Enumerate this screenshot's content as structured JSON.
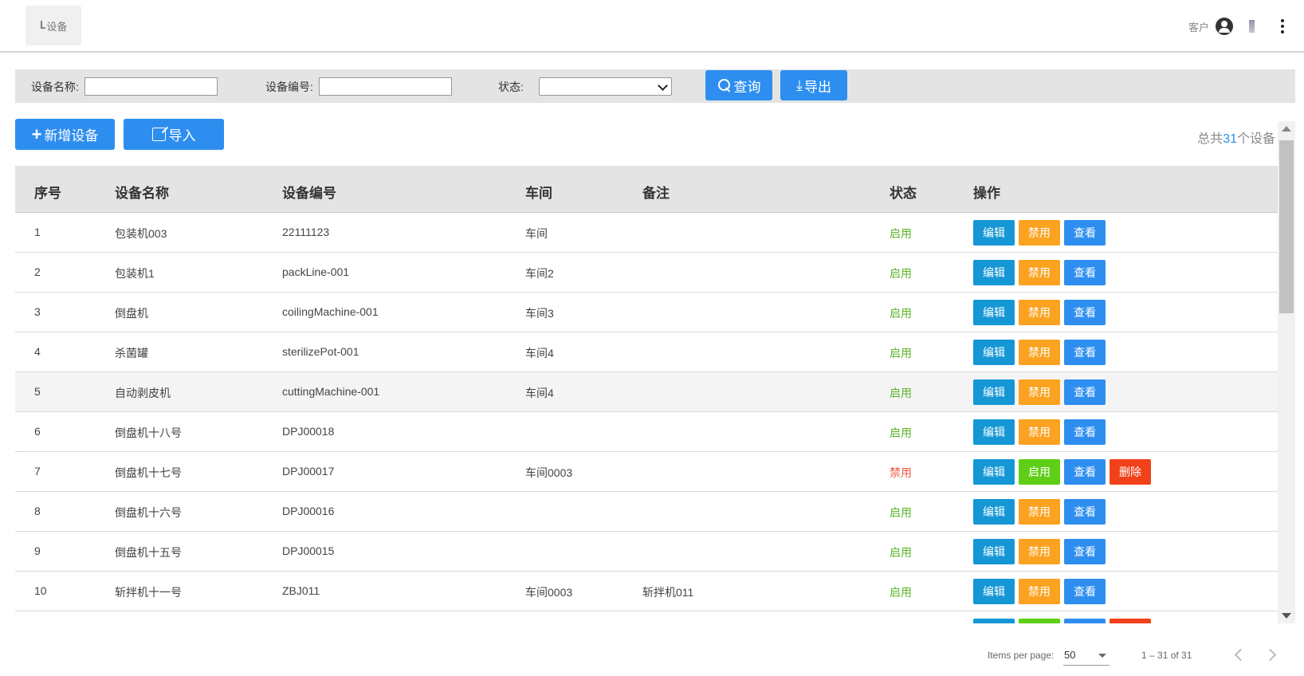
{
  "header": {
    "logo_glyph": "L",
    "logo_text": "设备",
    "username": "客户"
  },
  "filters": {
    "name_label": "设备名称:",
    "code_label": "设备编号:",
    "status_label": "状态:",
    "name_value": "",
    "code_value": "",
    "status_value": "",
    "search_label": "查询",
    "export_label": "导出"
  },
  "actions": {
    "add_label": "新增设备",
    "import_label": "导入",
    "total_prefix": "总共",
    "total_count": "31",
    "total_suffix": "个设备"
  },
  "table": {
    "columns": [
      "序号",
      "设备名称",
      "设备编号",
      "车间",
      "备注",
      "状态",
      "操作"
    ],
    "rows": [
      {
        "no": "1",
        "name": "包装机003",
        "code": "22111123",
        "workshop": "车间",
        "note": "",
        "status": "启用",
        "ops": [
          "编辑",
          "禁用",
          "查看"
        ]
      },
      {
        "no": "2",
        "name": "包装机1",
        "code": "packLine-001",
        "workshop": "车间2",
        "note": "",
        "status": "启用",
        "ops": [
          "编辑",
          "禁用",
          "查看"
        ]
      },
      {
        "no": "3",
        "name": "倒盘机",
        "code": "coilingMachine-001",
        "workshop": "车间3",
        "note": "",
        "status": "启用",
        "ops": [
          "编辑",
          "禁用",
          "查看"
        ]
      },
      {
        "no": "4",
        "name": "杀菌罐",
        "code": "sterilizePot-001",
        "workshop": "车间4",
        "note": "",
        "status": "启用",
        "ops": [
          "编辑",
          "禁用",
          "查看"
        ]
      },
      {
        "no": "5",
        "name": "自动剥皮机",
        "code": "cuttingMachine-001",
        "workshop": "车间4",
        "note": "",
        "status": "启用",
        "ops": [
          "编辑",
          "禁用",
          "查看"
        ]
      },
      {
        "no": "6",
        "name": "倒盘机十八号",
        "code": "DPJ00018",
        "workshop": "",
        "note": "",
        "status": "启用",
        "ops": [
          "编辑",
          "禁用",
          "查看"
        ]
      },
      {
        "no": "7",
        "name": "倒盘机十七号",
        "code": "DPJ00017",
        "workshop": "车间0003",
        "note": "",
        "status": "禁用",
        "ops": [
          "编辑",
          "启用",
          "查看",
          "删除"
        ]
      },
      {
        "no": "8",
        "name": "倒盘机十六号",
        "code": "DPJ00016",
        "workshop": "",
        "note": "",
        "status": "启用",
        "ops": [
          "编辑",
          "禁用",
          "查看"
        ]
      },
      {
        "no": "9",
        "name": "倒盘机十五号",
        "code": "DPJ00015",
        "workshop": "",
        "note": "",
        "status": "启用",
        "ops": [
          "编辑",
          "禁用",
          "查看"
        ]
      },
      {
        "no": "10",
        "name": "斩拌机十一号",
        "code": "ZBJ011",
        "workshop": "车间0003",
        "note": "斩拌机011",
        "status": "启用",
        "ops": [
          "编辑",
          "禁用",
          "查看"
        ]
      },
      {
        "no": "",
        "name": "",
        "code": "",
        "workshop": "",
        "note": "",
        "status": "",
        "ops": [
          "",
          "",
          "",
          ""
        ]
      }
    ]
  },
  "paginator": {
    "items_label": "Items per page:",
    "page_size": "50",
    "range": "1 – 31 of 31"
  },
  "colors": {
    "primary": "#2e8ef0",
    "edit": "#1597d5",
    "disable": "#fba220",
    "enable": "#5ecf16",
    "delete": "#f2411a",
    "status_on": "#5ab527",
    "status_off": "#ee5a40"
  }
}
